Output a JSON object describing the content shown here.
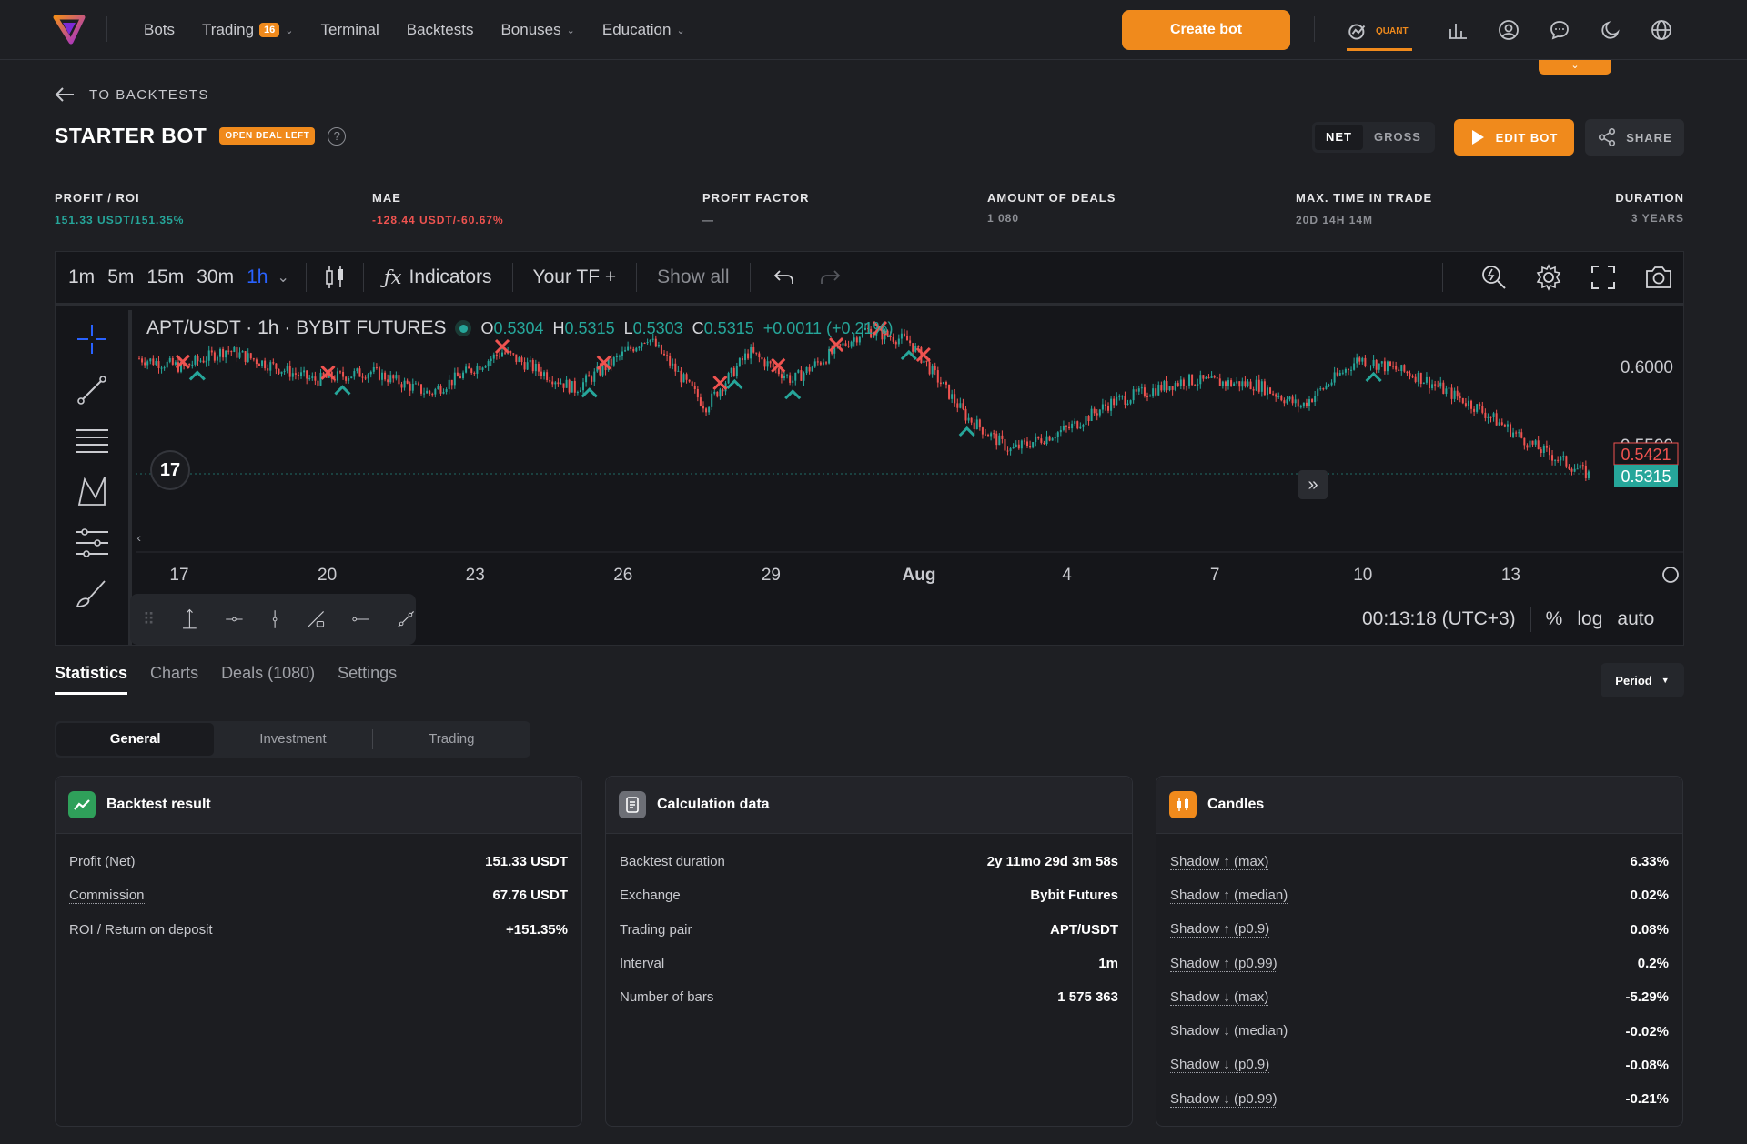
{
  "nav": {
    "items": [
      {
        "label": "Bots"
      },
      {
        "label": "Trading",
        "badge": "16"
      },
      {
        "label": "Terminal"
      },
      {
        "label": "Backtests"
      },
      {
        "label": "Bonuses"
      },
      {
        "label": "Education"
      }
    ],
    "create_bot": "Create bot",
    "quant_label": "QUANT",
    "accent": "#f08a1c"
  },
  "header": {
    "back_label": "TO BACKTESTS",
    "title": "STARTER BOT",
    "badge": "OPEN DEAL LEFT",
    "net": "NET",
    "gross": "GROSS",
    "edit_bot": "EDIT BOT",
    "share": "SHARE"
  },
  "metrics": [
    {
      "label": "PROFIT / ROI",
      "value": "151.33 USDT/151.35%",
      "color": "#26a69a"
    },
    {
      "label": "MAE",
      "value": "-128.44 USDT/-60.67%",
      "color": "#ef5350"
    },
    {
      "label": "PROFIT FACTOR",
      "value": "—",
      "color": "#8d8f95"
    },
    {
      "label": "AMOUNT OF DEALS",
      "value": "1 080",
      "color": "#8d8f95"
    },
    {
      "label": "MAX. TIME IN TRADE",
      "value": "20D 14H 14M",
      "color": "#8d8f95"
    },
    {
      "label": "DURATION",
      "value": "3 YEARS",
      "color": "#8d8f95"
    }
  ],
  "chart": {
    "timeframes": [
      "1m",
      "5m",
      "15m",
      "30m",
      "1h"
    ],
    "active_tf": "1h",
    "indicators": "Indicators",
    "your_tf": "Your TF +",
    "show_all": "Show all",
    "symbol": "APT/USDT · 1h · BYBIT FUTURES",
    "ohlc": {
      "o": "0.5304",
      "h": "0.5315",
      "l": "0.5303",
      "c": "0.5315",
      "chg": "+0.0011 (+0.21%)"
    },
    "price_labels": [
      "0.6000",
      "0.5500"
    ],
    "price_current": "0.5315",
    "price_marker": "0.5421",
    "x_ticks": [
      "17",
      "20",
      "23",
      "26",
      "29",
      "Aug",
      "4",
      "7",
      "10",
      "13"
    ],
    "time": "00:13:18 (UTC+3)",
    "scale_opts": [
      "%",
      "log",
      "auto"
    ]
  },
  "tabs": {
    "items": [
      "Statistics",
      "Charts",
      "Deals (1080)",
      "Settings"
    ],
    "period": "Period"
  },
  "subtabs": [
    "General",
    "Investment",
    "Trading"
  ],
  "cards": {
    "backtest": {
      "title": "Backtest result",
      "rows": [
        {
          "k": "Profit (Net)",
          "v": "151.33 USDT"
        },
        {
          "k": "Commission",
          "v": "67.76 USDT"
        },
        {
          "k": "ROI / Return on deposit",
          "v": "+151.35%"
        }
      ]
    },
    "calc": {
      "title": "Calculation data",
      "rows": [
        {
          "k": "Backtest duration",
          "v": "2y 11mo 29d 3m 58s"
        },
        {
          "k": "Exchange",
          "v": "Bybit Futures"
        },
        {
          "k": "Trading pair",
          "v": "APT/USDT"
        },
        {
          "k": "Interval",
          "v": "1m"
        },
        {
          "k": "Number of bars",
          "v": "1 575 363"
        }
      ]
    },
    "candles": {
      "title": "Candles",
      "rows": [
        {
          "k": "Shadow ↑ (max)",
          "v": "6.33%"
        },
        {
          "k": "Shadow ↑ (median)",
          "v": "0.02%"
        },
        {
          "k": "Shadow ↑ (p0.9)",
          "v": "0.08%"
        },
        {
          "k": "Shadow ↑ (p0.99)",
          "v": "0.2%"
        },
        {
          "k": "Shadow ↓ (max)",
          "v": "-5.29%"
        },
        {
          "k": "Shadow ↓ (median)",
          "v": "-0.02%"
        },
        {
          "k": "Shadow ↓ (p0.9)",
          "v": "-0.08%"
        },
        {
          "k": "Shadow ↓ (p0.99)",
          "v": "-0.21%"
        }
      ]
    }
  }
}
